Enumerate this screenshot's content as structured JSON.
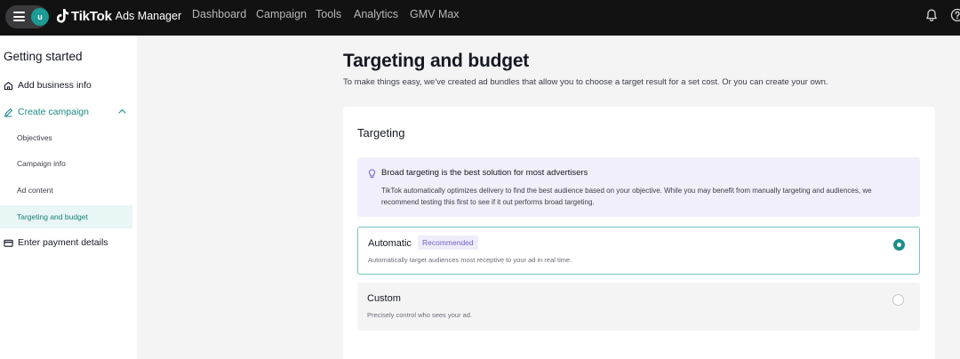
{
  "topbar": {
    "avatar_letter": "u",
    "brand_name": "TikTok",
    "brand_product": "Ads Manager",
    "nav": [
      "Dashboard",
      "Campaign",
      "Tools",
      "Analytics",
      "GMV Max"
    ],
    "icons": {
      "menu": "hamburger-icon",
      "notifications": "bell-icon",
      "help": "help-icon"
    }
  },
  "sidebar": {
    "title": "Getting started",
    "items": {
      "business": "Add business info",
      "campaign": "Create campaign",
      "payment": "Enter payment details"
    },
    "sub_items": [
      "Objectives",
      "Campaign info",
      "Ad content",
      "Targeting and budget"
    ],
    "active_sub_item": "Targeting and budget"
  },
  "main": {
    "title": "Targeting and budget",
    "subtitle": "To make things easy, we've created ad bundles that allow you to choose a target result for a set cost. Or you can create your own.",
    "card": {
      "title": "Targeting",
      "info": {
        "title": "Broad targeting is the best solution for most advertisers",
        "body": "TikTok automatically optimizes delivery to find the best audience based on your objective. While you may benefit from manually targeting and audiences, we recommend testing this first to see if it out performs broad targeting."
      },
      "options": [
        {
          "label": "Automatic",
          "badge": "Recommended",
          "description": "Automatically target audiences most receptive to your ad in real time.",
          "selected": true
        },
        {
          "label": "Custom",
          "description": "Precisely control who sees your ad.",
          "selected": false
        }
      ]
    }
  },
  "colors": {
    "topbar_bg": "#121212",
    "accent_teal": "#1a8f89",
    "badge_purple": "#7761c9",
    "info_bg": "#f1effb"
  }
}
